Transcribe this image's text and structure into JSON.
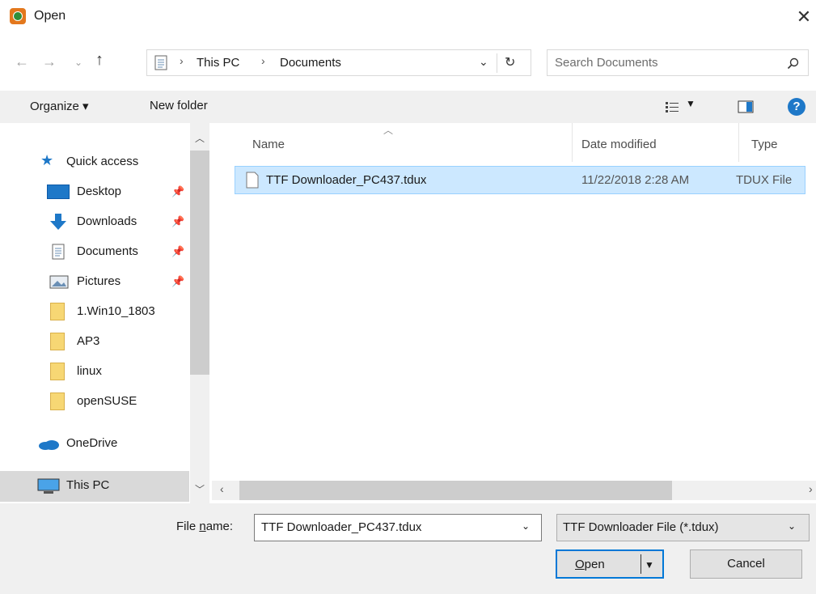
{
  "window": {
    "title": "Open",
    "close": "✕"
  },
  "address": {
    "crumbs": [
      "This PC",
      "Documents"
    ],
    "search_placeholder": "Search Documents"
  },
  "toolbar": {
    "organize": "Organize ▾",
    "new_folder": "New folder"
  },
  "sidebar": {
    "items": [
      {
        "label": "Quick access"
      },
      {
        "label": "Desktop",
        "pinned": true
      },
      {
        "label": "Downloads",
        "pinned": true
      },
      {
        "label": "Documents",
        "pinned": true
      },
      {
        "label": "Pictures",
        "pinned": true
      },
      {
        "label": "1.Win10_1803"
      },
      {
        "label": "AP3"
      },
      {
        "label": "linux"
      },
      {
        "label": "openSUSE"
      },
      {
        "label": "OneDrive"
      },
      {
        "label": "This PC"
      }
    ]
  },
  "columns": {
    "name": "Name",
    "date": "Date modified",
    "type": "Type"
  },
  "files": [
    {
      "name": "TTF Downloader_PC437.tdux",
      "date": "11/22/2018 2:28 AM",
      "type": "TDUX File"
    }
  ],
  "bottom": {
    "filename_label_pre": "File ",
    "filename_label_u": "n",
    "filename_label_post": "ame:",
    "filename_value": "TTF Downloader_PC437.tdux",
    "filter": "TTF Downloader File (*.tdux)",
    "open_u": "O",
    "open_rest": "pen",
    "cancel": "Cancel"
  },
  "colors": {
    "selection": "#cce8ff",
    "accent": "#0078d7"
  }
}
